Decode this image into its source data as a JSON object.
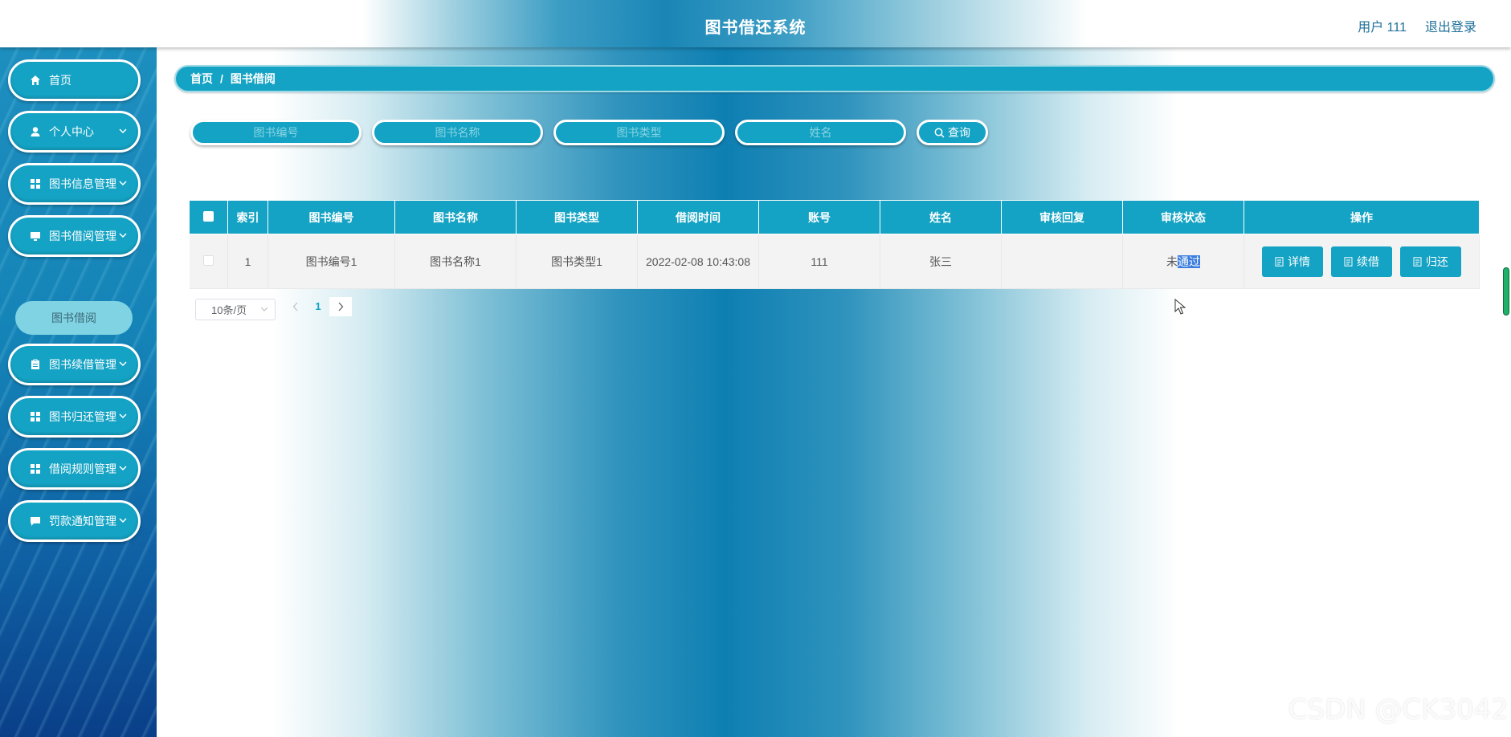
{
  "header": {
    "title": "图书借还系统",
    "user": "用户 111",
    "logout": "退出登录"
  },
  "sidebar": {
    "items": [
      {
        "label": "首页",
        "icon": "home-icon"
      },
      {
        "label": "个人中心",
        "icon": "user-icon"
      },
      {
        "label": "图书信息管理",
        "icon": "grid-icon"
      },
      {
        "label": "图书借阅管理",
        "icon": "monitor-icon"
      },
      {
        "label": "图书续借管理",
        "icon": "clipboard-icon"
      },
      {
        "label": "图书归还管理",
        "icon": "grid-icon"
      },
      {
        "label": "借阅规则管理",
        "icon": "grid-icon"
      },
      {
        "label": "罚款通知管理",
        "icon": "chat-icon"
      }
    ],
    "submenu_label": "图书借阅"
  },
  "breadcrumb": {
    "home": "首页",
    "sep": "/",
    "current": "图书借阅"
  },
  "search": {
    "book_no_placeholder": "图书编号",
    "book_name_placeholder": "图书名称",
    "book_type_placeholder": "图书类型",
    "name_placeholder": "姓名",
    "button": "查询"
  },
  "table": {
    "headers": [
      "索引",
      "图书编号",
      "图书名称",
      "图书类型",
      "借阅时间",
      "账号",
      "姓名",
      "审核回复",
      "审核状态",
      "操作"
    ],
    "rows": [
      {
        "index": "1",
        "book_no": "图书编号1",
        "book_name": "图书名称1",
        "book_type": "图书类型1",
        "borrow_time": "2022-02-08 10:43:08",
        "account": "111",
        "name": "张三",
        "reply": "",
        "status_prefix": "未",
        "status_highlight": "通过",
        "actions": [
          "详情",
          "续借",
          "归还"
        ]
      }
    ]
  },
  "pagination": {
    "page_size": "10条/页",
    "current_page": "1"
  },
  "watermark": "CSDN @CK3042",
  "colors": {
    "accent": "#14a3c4",
    "sidebar": "#1482b6",
    "selection": "#3b7de0"
  }
}
